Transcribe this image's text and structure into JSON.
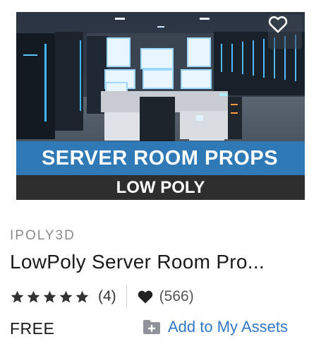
{
  "listing": {
    "banner_title": "SERVER ROOM PROPS",
    "banner_subtitle": "LOW POLY",
    "publisher": "IPOLY3D",
    "title": "LowPoly Server Room Pro...",
    "rating_count": "(4)",
    "rating_stars": 5,
    "favorite_count": "(566)",
    "price": "FREE",
    "add_to_assets_label": "Add to My Assets"
  },
  "colors": {
    "banner_blue": "#2f79b6",
    "link_blue": "#3277c4",
    "star": "#333333"
  },
  "icons": [
    "heart-outline-icon",
    "star-icon",
    "heart-filled-icon",
    "folder-icon"
  ]
}
